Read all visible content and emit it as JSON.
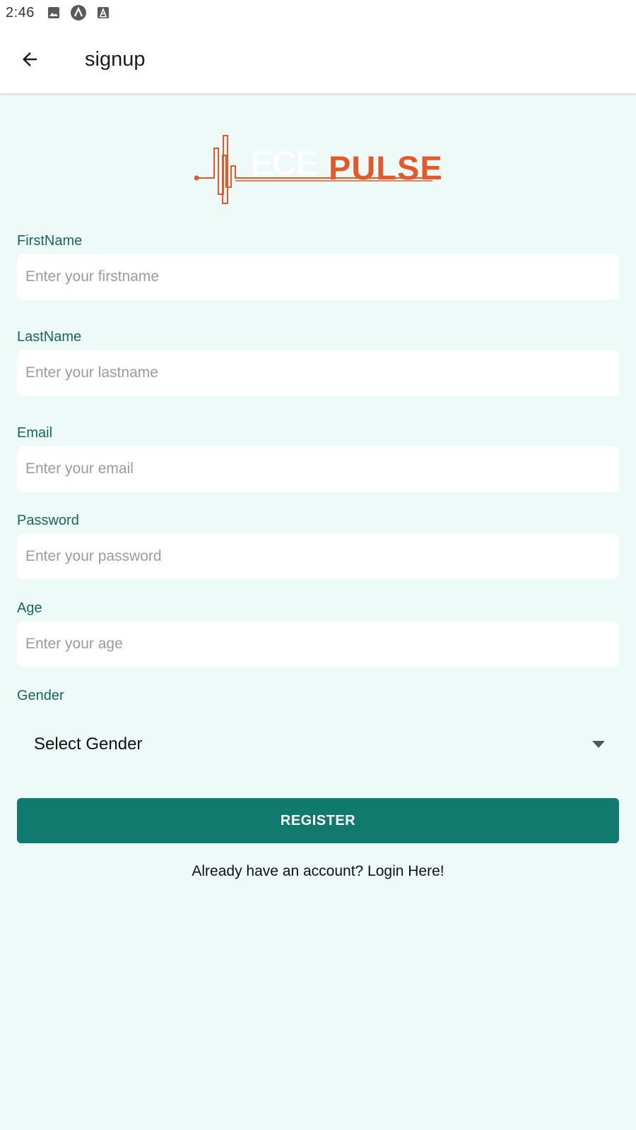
{
  "status_bar": {
    "time": "2:46",
    "icons": [
      "image-icon",
      "android-auto-icon",
      "a-notification-icon"
    ]
  },
  "app_bar": {
    "title": "signup",
    "back_icon": "arrow-left-icon"
  },
  "logo": {
    "prefix": "ECE",
    "text": "PULSE",
    "color": "#e25a2b"
  },
  "form": {
    "fields": [
      {
        "label": "FirstName",
        "placeholder": "Enter your firstname",
        "value": ""
      },
      {
        "label": "LastName",
        "placeholder": "Enter your lastname",
        "value": ""
      },
      {
        "label": "Email",
        "placeholder": "Enter your email",
        "value": ""
      },
      {
        "label": "Password",
        "placeholder": "Enter your password",
        "value": ""
      },
      {
        "label": "Age",
        "placeholder": "Enter your age",
        "value": ""
      }
    ],
    "gender": {
      "label": "Gender",
      "selected": "Select Gender",
      "icon": "dropdown-arrow-icon"
    },
    "register_label": "REGISTER",
    "login_text": "Already have an account? Login Here!"
  },
  "colors": {
    "background": "#eefaf8",
    "label": "#17665c",
    "primary": "#107a6f",
    "accent": "#e25a2b"
  }
}
